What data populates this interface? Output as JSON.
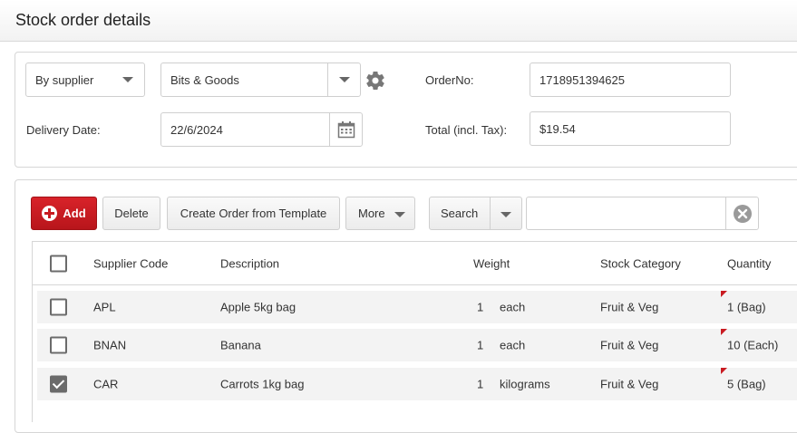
{
  "header": {
    "title": "Stock order details"
  },
  "order": {
    "filter_by": "By supplier",
    "supplier": "Bits & Goods",
    "order_no_label": "OrderNo:",
    "order_no": "1718951394625",
    "delivery_date_label": "Delivery Date:",
    "delivery_date": "22/6/2024",
    "total_label": "Total (incl. Tax):",
    "total": "$19.54"
  },
  "toolbar": {
    "add_label": "Add",
    "delete_label": "Delete",
    "create_template_label": "Create Order from Template",
    "more_label": "More",
    "search_label": "Search",
    "search_value": ""
  },
  "table": {
    "columns": [
      "Supplier Code",
      "Description",
      "Weight",
      "Stock Category",
      "Quantity"
    ],
    "rows": [
      {
        "code": "APL",
        "description": "Apple 5kg bag",
        "weight": "1",
        "unit": "each",
        "category": "Fruit & Veg",
        "quantity": "1 (Bag)",
        "checked": false
      },
      {
        "code": "BNAN",
        "description": "Banana",
        "weight": "1",
        "unit": "each",
        "category": "Fruit & Veg",
        "quantity": "10 (Each)",
        "checked": false
      },
      {
        "code": "CAR",
        "description": "Carrots 1kg bag",
        "weight": "1",
        "unit": "kilograms",
        "category": "Fruit & Veg",
        "quantity": "5 (Bag)",
        "checked": true
      }
    ]
  },
  "colors": {
    "accent": "#c91b21",
    "row_bg": "#f3f3f3",
    "border": "#d6d6d6"
  }
}
